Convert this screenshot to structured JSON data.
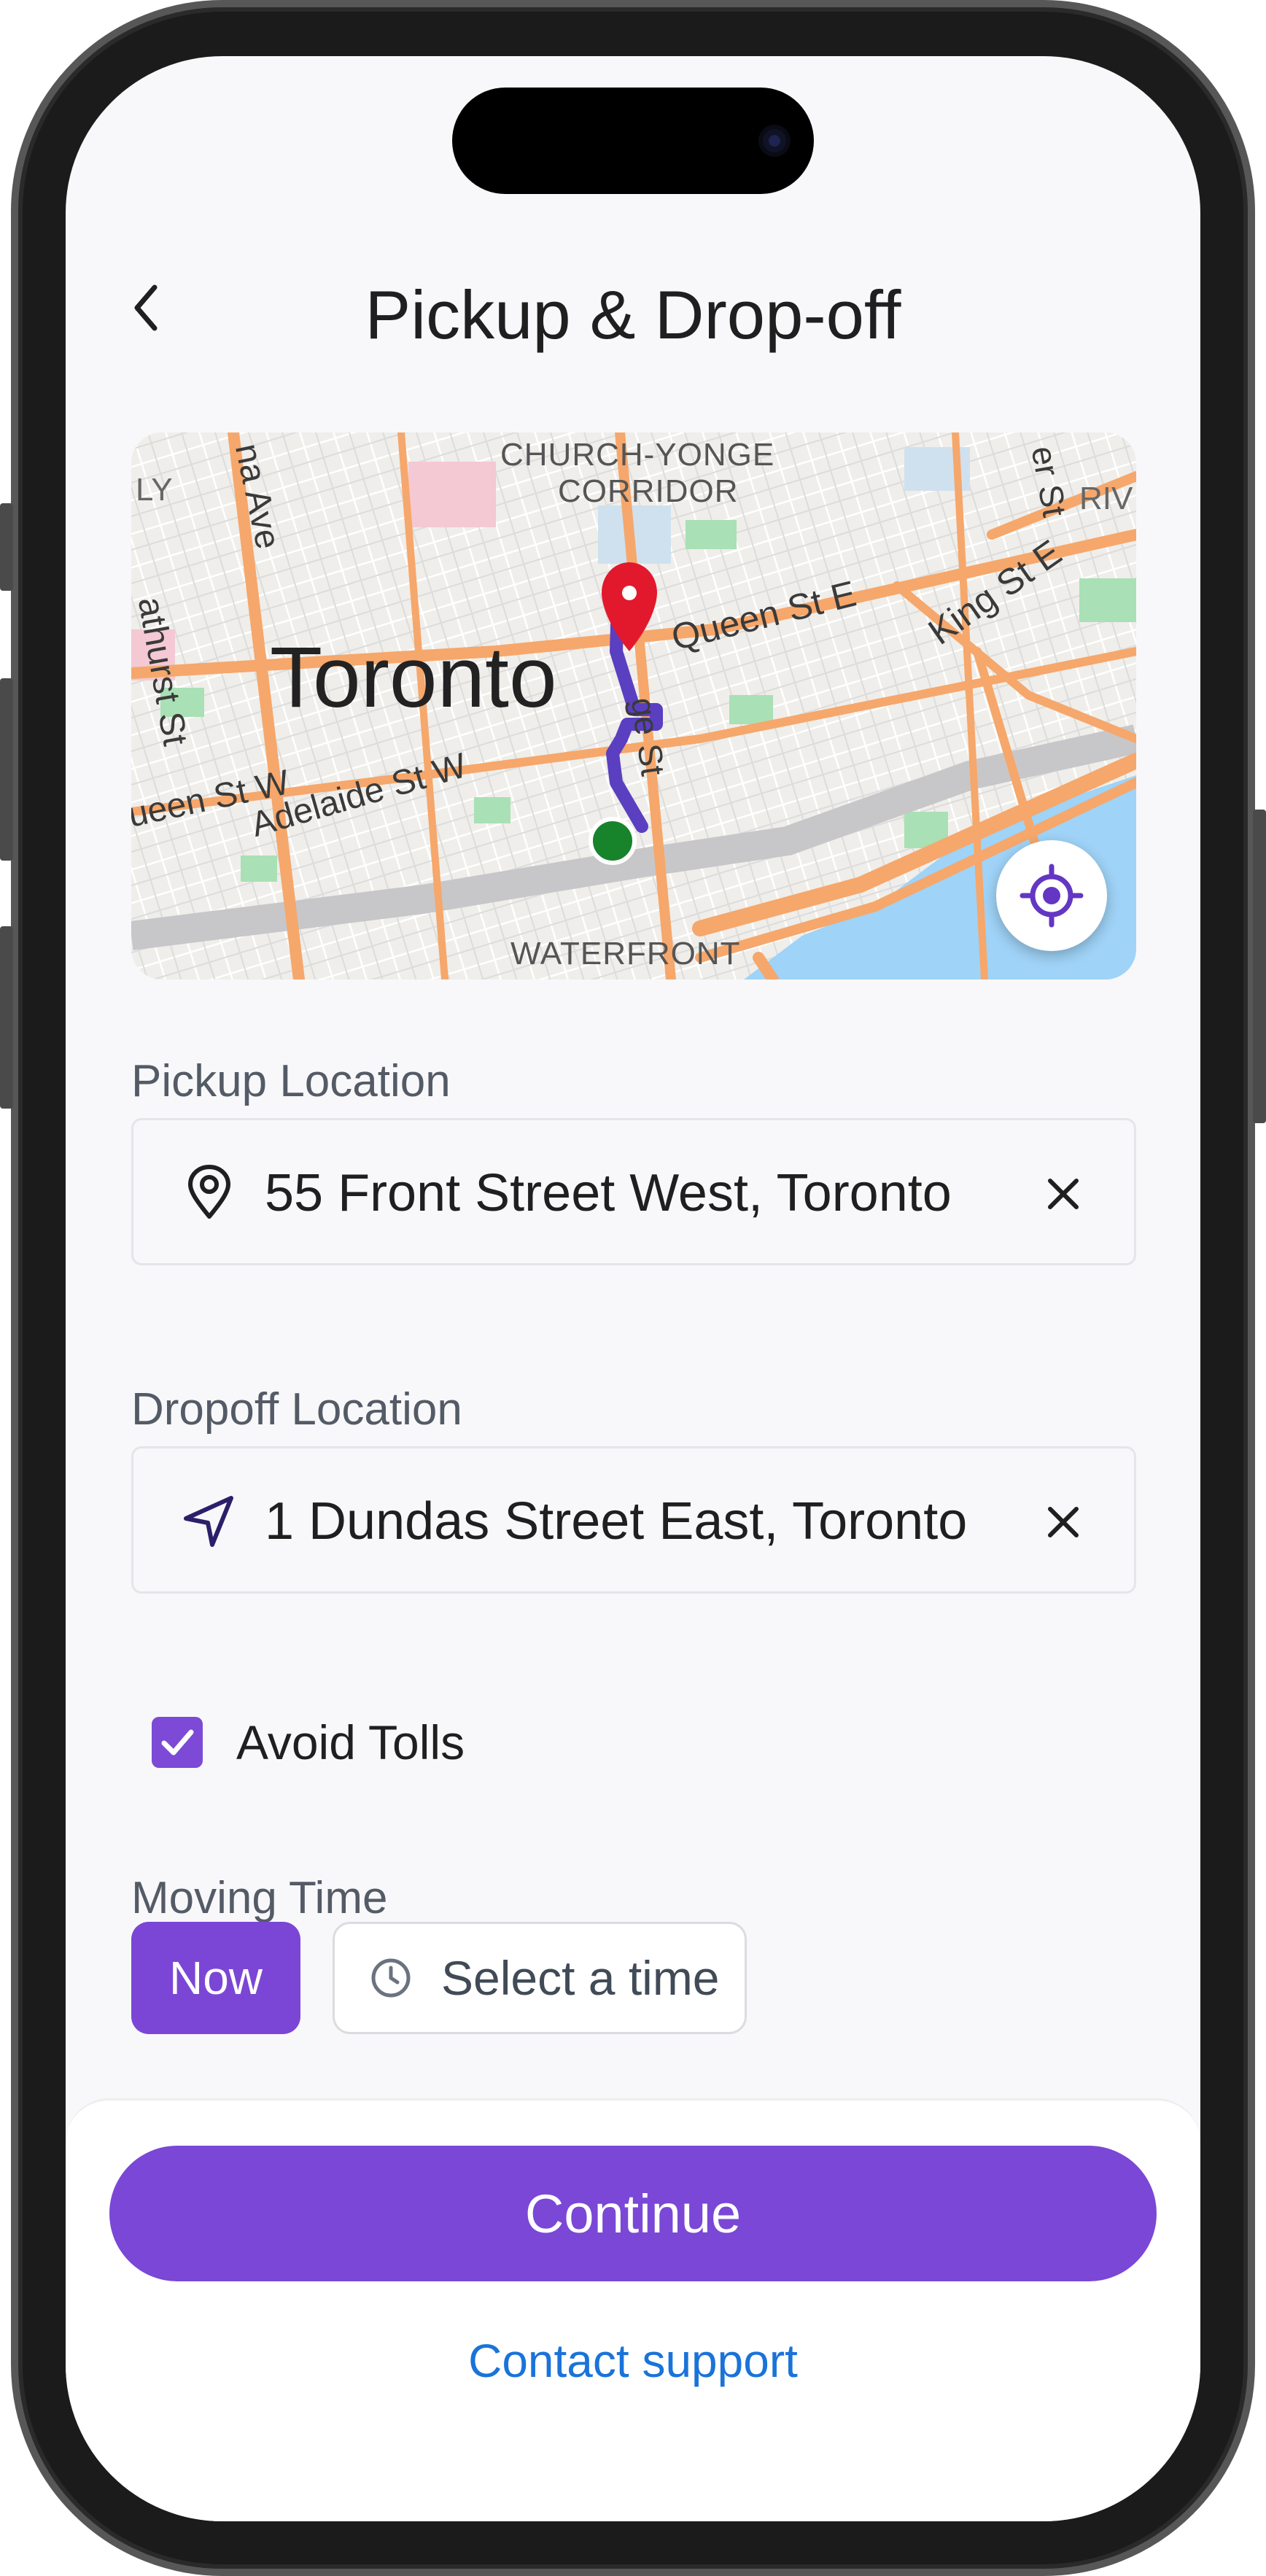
{
  "header": {
    "title": "Pickup & Drop-off"
  },
  "map": {
    "labels": {
      "city": "Toronto",
      "district_top_1": "CHURCH-YONGE",
      "district_top_2": "CORRIDOR",
      "waterfront": "WATERFRONT",
      "queen_st_e": "Queen St E",
      "king_st_e": "King St E",
      "adelaide_st_w": "Adelaide St W",
      "queen_st_w": "ueen St W",
      "bathurst_st": "athurst St",
      "spadina_ave": "na Ave",
      "yonge_st": "ge St",
      "corner_ly": "LY",
      "corner_riv": "RIV",
      "corner_st": "er St"
    },
    "colors": {
      "route": "#5a3fc0",
      "pickup_marker": "#17832b",
      "dropoff_marker": "#e2182d",
      "arterial": "#f6a76b",
      "water": "#9fd3f7"
    }
  },
  "pickup": {
    "label": "Pickup Location",
    "value": "55 Front Street West, Toronto",
    "icon": "map-pin-icon"
  },
  "dropoff": {
    "label": "Dropoff Location",
    "value": "1 Dundas Street East, Toronto",
    "icon": "navigation-arrow-icon"
  },
  "options": {
    "avoid_tolls_label": "Avoid Tolls",
    "avoid_tolls_checked": true
  },
  "moving_time": {
    "label": "Moving Time",
    "now_label": "Now",
    "select_label": "Select a time"
  },
  "footer": {
    "continue_label": "Continue",
    "support_label": "Contact support"
  },
  "theme": {
    "accent": "#7a47d6",
    "link": "#1a73d9"
  }
}
